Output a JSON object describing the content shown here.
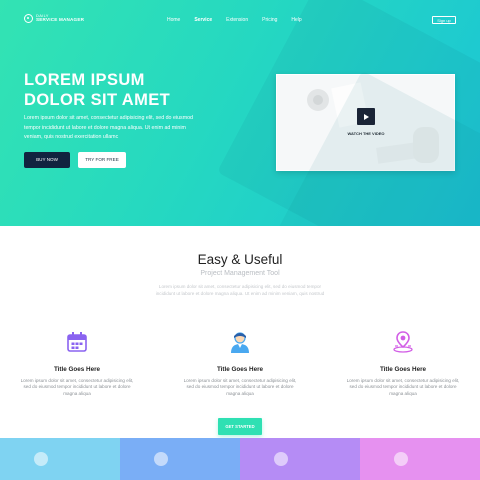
{
  "brand": {
    "small": "DAILY",
    "big": "SERVICE MANAGER"
  },
  "nav": {
    "items": [
      "Home",
      "Service",
      "Extension",
      "Pricing",
      "Help"
    ],
    "active": "Service",
    "signup": "Sign up"
  },
  "hero": {
    "title_line1": "LOREM IPSUM",
    "title_line2": "DOLOR SIT AMET",
    "text": "Lorem ipsum dolor sit amet, consectetur adipisicing elit, sed do eiusmod tempor incididunt ut labore et dolore magna aliqua. Ut enim ad minim veniam, quis nostrud exercitation ullamc",
    "buy_label": "BUY NOW",
    "try_label": "TRY FOR FREE",
    "video_label": "WATCH THE VIDEO"
  },
  "section": {
    "title": "Easy & Useful",
    "subtitle": "Project Management Tool",
    "desc": "Lorem ipsum dolor sit amet, consectetur adipisicing elit, sed do eiusmod tempor incididunt ut labore et dolore magna aliqua. Ut enim ad minim veniam, quis nostrud"
  },
  "features": [
    {
      "icon": "calendar-icon",
      "title": "Title Goes Here",
      "text": "Lorem ipsum dolor sit amet, consectetur adipisicing elit, sed do eiusmod tempor incididunt ut labore et dolore magna aliqua"
    },
    {
      "icon": "person-icon",
      "title": "Title Goes Here",
      "text": "Lorem ipsum dolor sit amet, consectetur adipisicing elit, sed do eiusmod tempor incididunt ut labore et dolore magna aliqua"
    },
    {
      "icon": "location-pin-icon",
      "title": "Title Goes Here",
      "text": "Lorem ipsum dolor sit amet, consectetur adipisicing elit, sed do eiusmod tempor incididunt ut labore et dolore magna aliqua"
    }
  ],
  "cta": {
    "label": "GET STARTED"
  },
  "colors": {
    "hero_start": "#33e3b3",
    "hero_end": "#1bc4d6",
    "dark_button": "#11233f",
    "cta": "#2fe0b3",
    "icon_purple": "#8a63f0",
    "icon_blue": "#49a8f0",
    "icon_pink": "#d25fe6",
    "strip": [
      "#7fd3f2",
      "#7aaef6",
      "#b58cf5",
      "#e691f0"
    ]
  }
}
